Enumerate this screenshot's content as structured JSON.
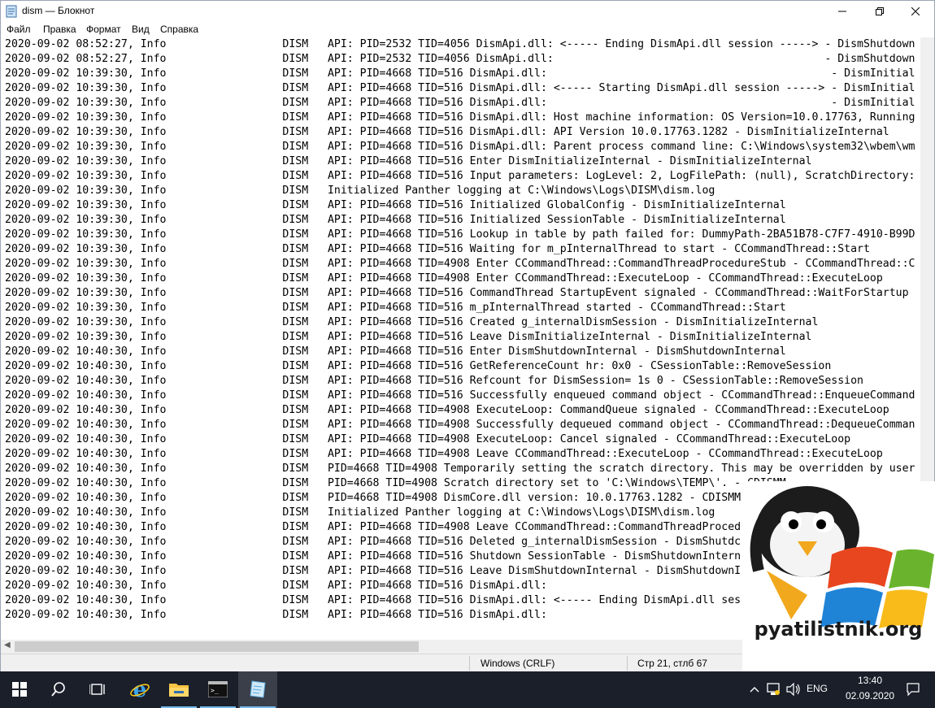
{
  "window": {
    "title": "dism — Блокнот",
    "minimize_icon": "minimize-icon",
    "maximize_icon": "maximize-icon",
    "close_icon": "close-icon"
  },
  "menu": [
    {
      "label": "Файл"
    },
    {
      "label": "Правка"
    },
    {
      "label": "Формат"
    },
    {
      "label": "Вид"
    },
    {
      "label": "Справка"
    }
  ],
  "lines": [
    "2020-09-02 08:52:27, Info                  DISM   API: PID=2532 TID=4056 DismApi.dll: <----- Ending DismApi.dll session -----> - DismShutdown",
    "2020-09-02 08:52:27, Info                  DISM   API: PID=2532 TID=4056 DismApi.dll:                                          - DismShutdown",
    "2020-09-02 10:39:30, Info                  DISM   API: PID=4668 TID=516 DismApi.dll:                                            - DismInitial",
    "2020-09-02 10:39:30, Info                  DISM   API: PID=4668 TID=516 DismApi.dll: <----- Starting DismApi.dll session -----> - DismInitial",
    "2020-09-02 10:39:30, Info                  DISM   API: PID=4668 TID=516 DismApi.dll:                                            - DismInitial",
    "2020-09-02 10:39:30, Info                  DISM   API: PID=4668 TID=516 DismApi.dll: Host machine information: OS Version=10.0.17763, Running",
    "2020-09-02 10:39:30, Info                  DISM   API: PID=4668 TID=516 DismApi.dll: API Version 10.0.17763.1282 - DismInitializeInternal",
    "2020-09-02 10:39:30, Info                  DISM   API: PID=4668 TID=516 DismApi.dll: Parent process command line: C:\\Windows\\system32\\wbem\\wm",
    "2020-09-02 10:39:30, Info                  DISM   API: PID=4668 TID=516 Enter DismInitializeInternal - DismInitializeInternal",
    "2020-09-02 10:39:30, Info                  DISM   API: PID=4668 TID=516 Input parameters: LogLevel: 2, LogFilePath: (null), ScratchDirectory:",
    "2020-09-02 10:39:30, Info                  DISM   Initialized Panther logging at C:\\Windows\\Logs\\DISM\\dism.log",
    "2020-09-02 10:39:30, Info                  DISM   API: PID=4668 TID=516 Initialized GlobalConfig - DismInitializeInternal",
    "2020-09-02 10:39:30, Info                  DISM   API: PID=4668 TID=516 Initialized SessionTable - DismInitializeInternal",
    "2020-09-02 10:39:30, Info                  DISM   API: PID=4668 TID=516 Lookup in table by path failed for: DummyPath-2BA51B78-C7F7-4910-B99D",
    "2020-09-02 10:39:30, Info                  DISM   API: PID=4668 TID=516 Waiting for m_pInternalThread to start - CCommandThread::Start",
    "2020-09-02 10:39:30, Info                  DISM   API: PID=4668 TID=4908 Enter CCommandThread::CommandThreadProcedureStub - CCommandThread::C",
    "2020-09-02 10:39:30, Info                  DISM   API: PID=4668 TID=4908 Enter CCommandThread::ExecuteLoop - CCommandThread::ExecuteLoop",
    "2020-09-02 10:39:30, Info                  DISM   API: PID=4668 TID=516 CommandThread StartupEvent signaled - CCommandThread::WaitForStartup",
    "2020-09-02 10:39:30, Info                  DISM   API: PID=4668 TID=516 m_pInternalThread started - CCommandThread::Start",
    "2020-09-02 10:39:30, Info                  DISM   API: PID=4668 TID=516 Created g_internalDismSession - DismInitializeInternal",
    "2020-09-02 10:39:30, Info                  DISM   API: PID=4668 TID=516 Leave DismInitializeInternal - DismInitializeInternal",
    "2020-09-02 10:40:30, Info                  DISM   API: PID=4668 TID=516 Enter DismShutdownInternal - DismShutdownInternal",
    "2020-09-02 10:40:30, Info                  DISM   API: PID=4668 TID=516 GetReferenceCount hr: 0x0 - CSessionTable::RemoveSession",
    "2020-09-02 10:40:30, Info                  DISM   API: PID=4668 TID=516 Refcount for DismSession= 1s 0 - CSessionTable::RemoveSession",
    "2020-09-02 10:40:30, Info                  DISM   API: PID=4668 TID=516 Successfully enqueued command object - CCommandThread::EnqueueCommand",
    "2020-09-02 10:40:30, Info                  DISM   API: PID=4668 TID=4908 ExecuteLoop: CommandQueue signaled - CCommandThread::ExecuteLoop",
    "2020-09-02 10:40:30, Info                  DISM   API: PID=4668 TID=4908 Successfully dequeued command object - CCommandThread::DequeueComman",
    "2020-09-02 10:40:30, Info                  DISM   API: PID=4668 TID=4908 ExecuteLoop: Cancel signaled - CCommandThread::ExecuteLoop",
    "2020-09-02 10:40:30, Info                  DISM   API: PID=4668 TID=4908 Leave CCommandThread::ExecuteLoop - CCommandThread::ExecuteLoop",
    "2020-09-02 10:40:30, Info                  DISM   PID=4668 TID=4908 Temporarily setting the scratch directory. This may be overridden by user",
    "2020-09-02 10:40:30, Info                  DISM   PID=4668 TID=4908 Scratch directory set to 'C:\\Windows\\TEMP\\'. - CDISMM",
    "2020-09-02 10:40:30, Info                  DISM   PID=4668 TID=4908 DismCore.dll version: 10.0.17763.1282 - CDISMM",
    "2020-09-02 10:40:30, Info                  DISM   Initialized Panther logging at C:\\Windows\\Logs\\DISM\\dism.log",
    "2020-09-02 10:40:30, Info                  DISM   API: PID=4668 TID=4908 Leave CCommandThread::CommandThreadProced",
    "2020-09-02 10:40:30, Info                  DISM   API: PID=4668 TID=516 Deleted g_internalDismSession - DismShutdc",
    "2020-09-02 10:40:30, Info                  DISM   API: PID=4668 TID=516 Shutdown SessionTable - DismShutdownIntern",
    "2020-09-02 10:40:30, Info                  DISM   API: PID=4668 TID=516 Leave DismShutdownInternal - DismShutdownI",
    "2020-09-02 10:40:30, Info                  DISM   API: PID=4668 TID=516 DismApi.dll:",
    "2020-09-02 10:40:30, Info                  DISM   API: PID=4668 TID=516 DismApi.dll: <----- Ending DismApi.dll ses",
    "2020-09-02 10:40:30, Info                  DISM   API: PID=4668 TID=516 DismApi.dll:"
  ],
  "status": {
    "encoding": "Windows (CRLF)",
    "position": "Стр 21, стлб 67"
  },
  "watermark": {
    "text": "pyatilistnik.org"
  },
  "taskbar": {
    "items": [
      {
        "name": "start-button",
        "icon": "windows-logo-icon"
      },
      {
        "name": "search-button",
        "icon": "search-icon"
      },
      {
        "name": "task-view-button",
        "icon": "task-view-icon"
      },
      {
        "name": "ie-button",
        "icon": "internet-explorer-icon"
      },
      {
        "name": "explorer-button",
        "icon": "folder-icon"
      },
      {
        "name": "cmd-button",
        "icon": "command-prompt-icon"
      },
      {
        "name": "notepad-button",
        "icon": "notepad-icon"
      }
    ],
    "tray": {
      "language": "ENG",
      "time": "13:40",
      "date": "02.09.2020"
    }
  },
  "colors": {
    "taskbar_bg": "#1a1f2a",
    "active_task_underline": "#76b9ed",
    "status_bg": "#f0f0f0"
  }
}
